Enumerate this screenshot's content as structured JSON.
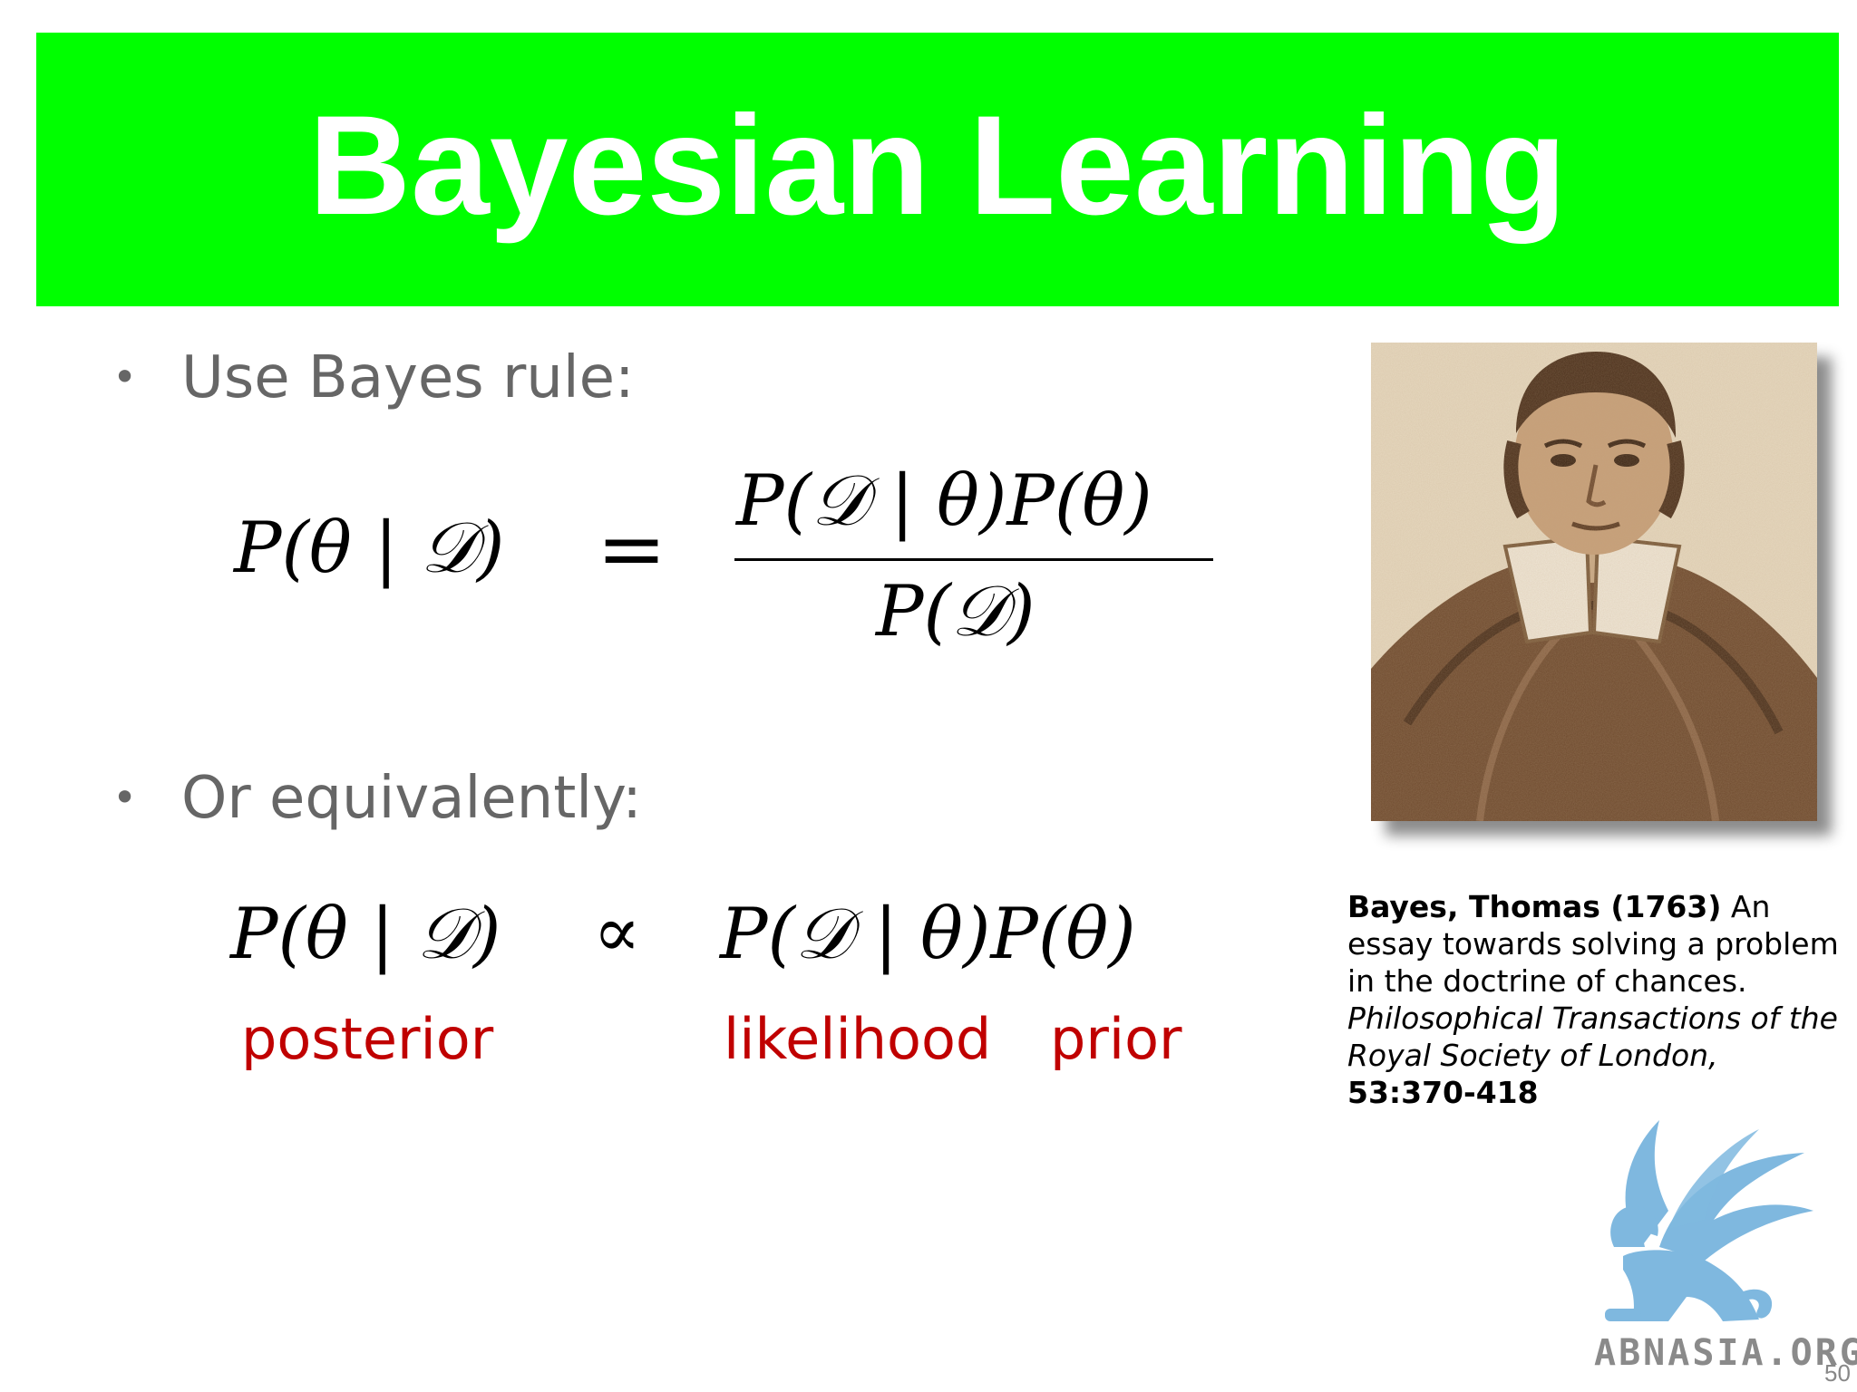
{
  "slide": {
    "title": "Bayesian Learning",
    "bullets": [
      {
        "text": "Use Bayes rule:"
      },
      {
        "text": "Or equivalently:"
      }
    ],
    "bullet_symbol": "•",
    "equation1": {
      "lhs": "P(θ | 𝒟)",
      "relation": "=",
      "numerator": "P(𝒟 | θ)P(θ)",
      "denominator": "P(𝒟)"
    },
    "equation2": {
      "lhs": "P(θ | 𝒟)",
      "relation": "∝",
      "rhs": "P(𝒟 | θ)P(θ)"
    },
    "labels": {
      "posterior": "posterior",
      "likelihood": "likelihood",
      "prior": "prior"
    },
    "caption": {
      "author_year": "Bayes, Thomas (1763)",
      "text1": " An essay towards solving a problem in the doctrine of chances. ",
      "journal": "Philosophical Transactions of the Royal Society of London,",
      "pages": " 53:370-418"
    },
    "logo_text": "ABNASIA.ORG",
    "page_number": "50"
  },
  "colors": {
    "title_bg": "#00ff00",
    "title_text": "#ffffff",
    "bullet_text": "#666666",
    "label_red": "#c00000",
    "logo_blue": "#7fb8df"
  },
  "icons": {
    "portrait": "thomas-bayes-portrait",
    "logo": "griffin-logo"
  }
}
